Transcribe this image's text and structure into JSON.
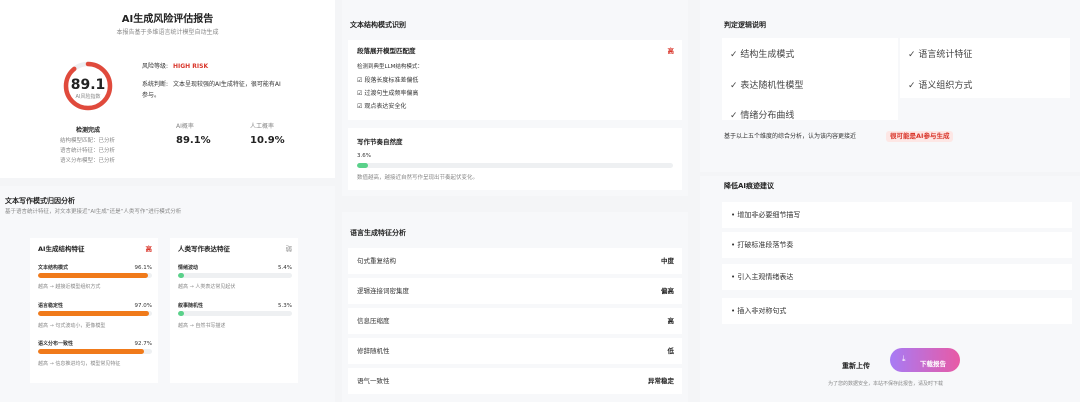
{
  "report": {
    "title": "AI生成风险评估报告",
    "subtitle": "本报告基于多维语言统计模型自动生成",
    "score": "89.1",
    "score_label": "AI风险指数",
    "score_fraction": 0.891,
    "risk_level_label": "风险等级:",
    "risk_level": "HIGH RISK",
    "judgement_label": "系统判断:",
    "judgement_line1": "文本呈现较强的AI生成特征，很可能有AI",
    "judgement_line2": "参与。",
    "detect_title": "检测完成",
    "detect_items": [
      "结构模型匹配：已分析",
      "语言统计特征：已分析",
      "语义分布模型：已分析"
    ],
    "ai_prob_label": "AI概率",
    "ai_prob": "89.1%",
    "human_prob_label": "人工概率",
    "human_prob": "10.9%"
  },
  "attribution": {
    "title": "文本写作模式归因分析",
    "desc": "基于语言统计特征，对文本更接近“AI生成”还是“人类写作”进行模式分析",
    "ai": {
      "title": "AI生成结构特征",
      "level": "高",
      "items": [
        {
          "name": "文本结构模式",
          "value": "96.1%",
          "fraction": 0.961,
          "note": "越高 → 越接近模型组织方式"
        },
        {
          "name": "语言稳定性",
          "value": "97.0%",
          "fraction": 0.97,
          "note": "越高 → 句式波动小，更像模型"
        },
        {
          "name": "语义分布一致性",
          "value": "92.7%",
          "fraction": 0.927,
          "note": "越高 → 信息推进均匀，模型常见特征"
        }
      ]
    },
    "human": {
      "title": "人类写作表达特征",
      "level": "弱",
      "items": [
        {
          "name": "情绪波动",
          "value": "5.4%",
          "fraction": 0.054,
          "note": "越高 → 人类表达常见起伏"
        },
        {
          "name": "叙事随机性",
          "value": "5.3%",
          "fraction": 0.053,
          "note": "越高 → 自然书写描述"
        }
      ]
    }
  },
  "structure": {
    "title": "文本结构模式识别",
    "match_title": "段落展开模型匹配度",
    "match_level": "高",
    "match_desc": "检测到典型LLM结构模式：",
    "match_items": [
      "段落长度标准差偏低",
      "过渡句生成频率偏高",
      "观点表达安全化"
    ],
    "rhythm_title": "写作节奏自然度",
    "rhythm_value": "3.6%",
    "rhythm_fraction": 0.036,
    "rhythm_desc": "数值越高，越接近自然写作呈现出节奏起伏变化。"
  },
  "language": {
    "title": "语言生成特征分析",
    "rows": [
      {
        "name": "句式重复结构",
        "level": "中度"
      },
      {
        "name": "逻辑连接词密集度",
        "level": "偏高"
      },
      {
        "name": "信息压缩度",
        "level": "高"
      },
      {
        "name": "修辞随机性",
        "level": "低"
      },
      {
        "name": "语气一致性",
        "level": "异常稳定"
      }
    ]
  },
  "logic": {
    "title": "判定逻辑说明",
    "items": [
      "结构生成模式",
      "语言统计特征",
      "表达随机性模型",
      "语义组织方式",
      "情绪分布曲线"
    ],
    "summary": "基于以上五个维度的综合分析，认为该内容更接近",
    "verdict": "很可能是AI参与生成"
  },
  "suggest": {
    "title": "降低AI痕迹建议",
    "items": [
      "• 增加非必要细节描写",
      "• 打破标准段落节奏",
      "• 引入主观情绪表达",
      "• 插入非对称句式"
    ]
  },
  "actions": {
    "reupload": "重新上传",
    "download": "下载报告",
    "privacy": "为了您的数据安全，本站不保存此报告，请及时下载"
  },
  "colors": {
    "accent_red": "#d9362b",
    "bar_orange": "#f07a1a",
    "bar_green": "#5ad18a"
  }
}
